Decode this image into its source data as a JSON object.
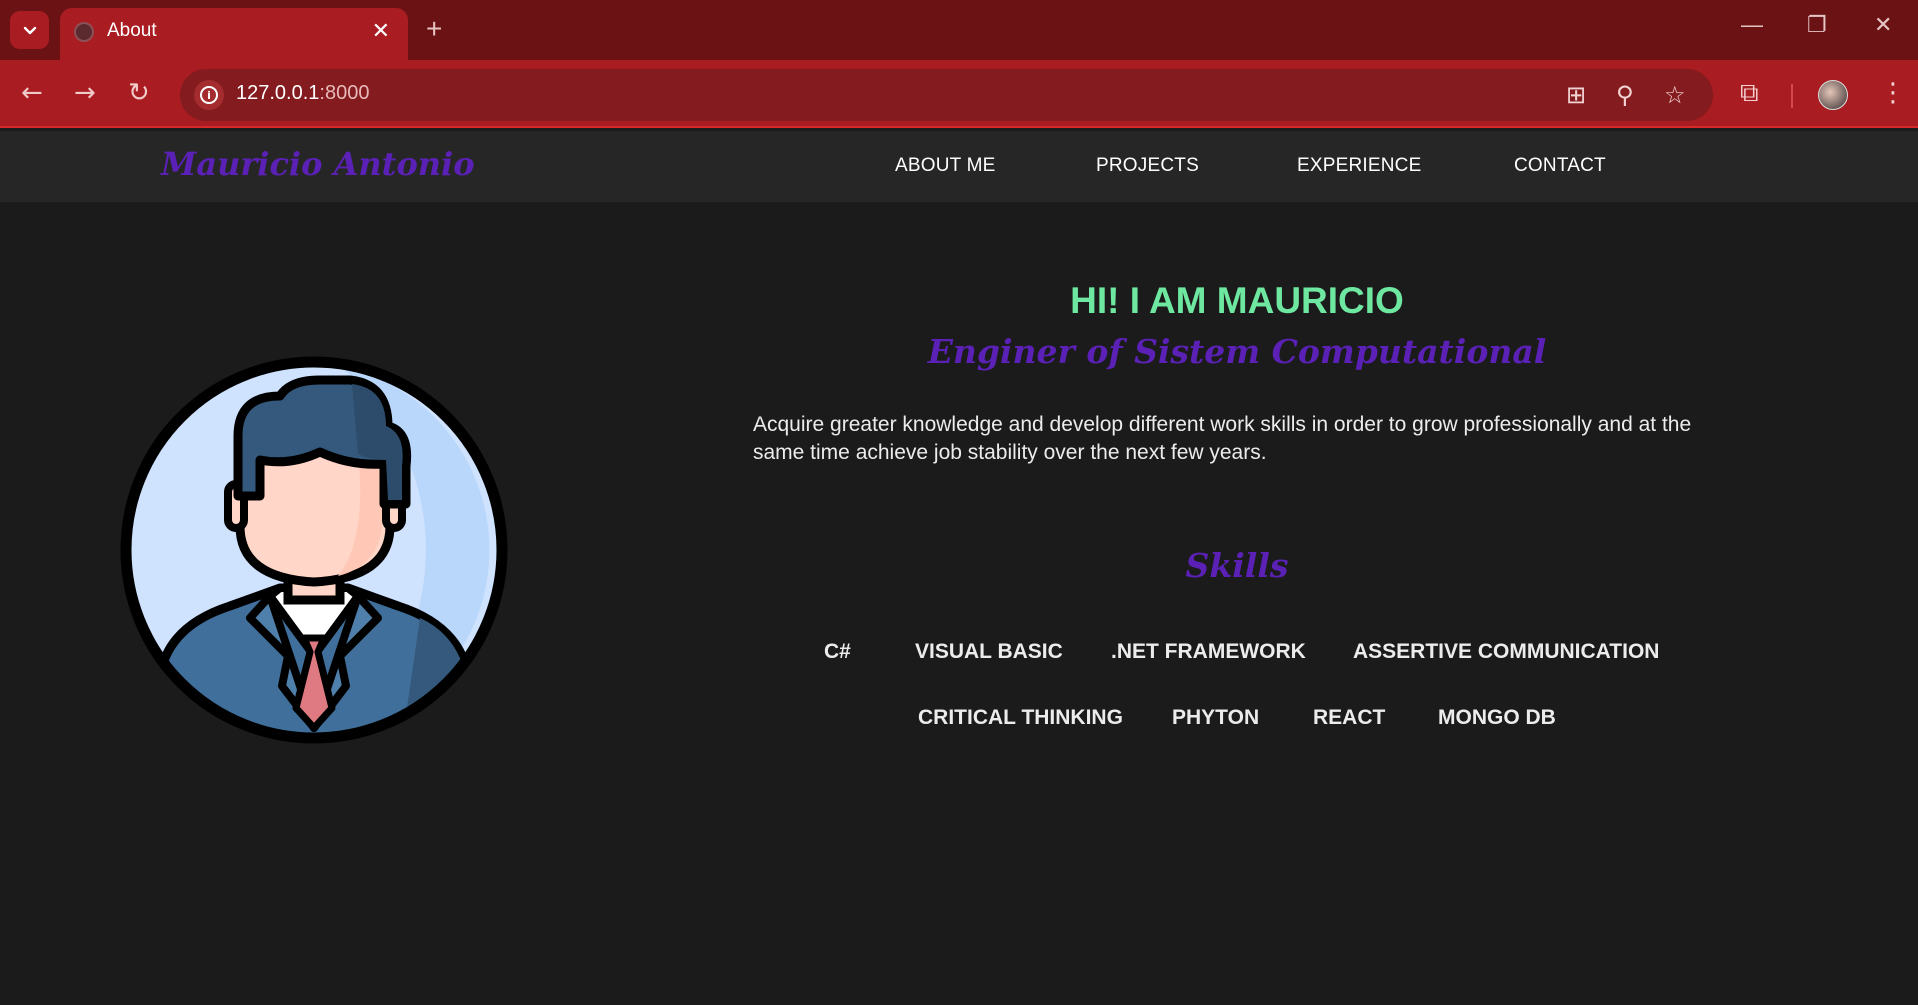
{
  "browser": {
    "tab_title": "About",
    "url_host": "127.0.0.1",
    "url_port": ":8000"
  },
  "site": {
    "logo": "Mauricio Antonio",
    "nav": [
      "ABOUT ME",
      "PROJECTS",
      "EXPERIENCE",
      "CONTACT"
    ]
  },
  "hero": {
    "title": "HI! I AM MAURICIO",
    "subtitle": "Enginer of Sistem Computational",
    "description": "Acquire greater knowledge and develop different work skills in order to grow professionally and at the same time achieve job stability over the next few years."
  },
  "skills": {
    "heading": "Skills",
    "items": [
      "C#",
      "VISUAL BASIC",
      ".NET FRAMEWORK",
      "ASSERTIVE COMMUNICATION",
      "CRITICAL THINKING",
      "PHYTON",
      "REACT",
      "MONGO DB"
    ]
  },
  "colors": {
    "accent_green": "#6ee7a0",
    "accent_purple": "#5b21b6",
    "chrome_red": "#a91c21",
    "background": "#1b1b1b"
  },
  "icons": [
    "tab-search-icon",
    "globe-icon",
    "close-icon",
    "plus-icon",
    "minimize-icon",
    "restore-icon",
    "back-icon",
    "forward-icon",
    "reload-icon",
    "info-icon",
    "translate-icon",
    "zoom-icon",
    "star-icon",
    "extensions-icon",
    "menu-icon"
  ]
}
